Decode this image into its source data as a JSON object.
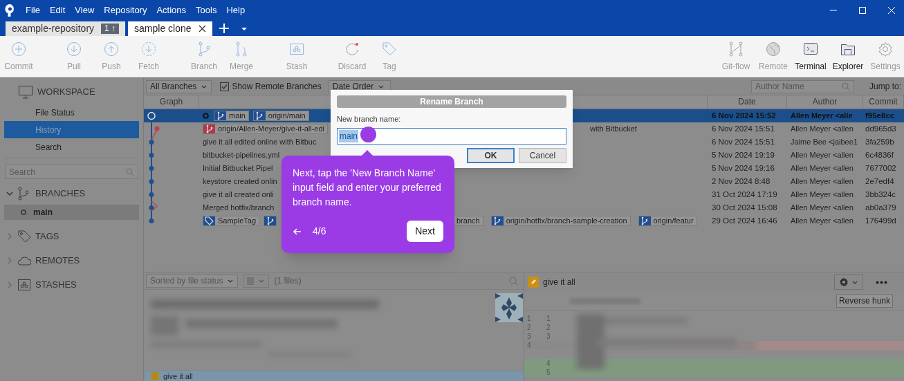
{
  "menu": [
    "File",
    "Edit",
    "View",
    "Repository",
    "Actions",
    "Tools",
    "Help"
  ],
  "tabs": [
    {
      "label": "example-repository",
      "badge": "1 ↑",
      "selected": false
    },
    {
      "label": "sample clone",
      "selected": true
    }
  ],
  "toolbar": {
    "groups": [
      [
        {
          "kind": "commit",
          "label": "Commit",
          "disabled": true
        }
      ],
      [
        {
          "kind": "pull",
          "label": "Pull",
          "disabled": true
        },
        {
          "kind": "push",
          "label": "Push",
          "disabled": true
        },
        {
          "kind": "fetch",
          "label": "Fetch",
          "disabled": true
        }
      ],
      [
        {
          "kind": "branch",
          "label": "Branch",
          "disabled": true
        },
        {
          "kind": "merge",
          "label": "Merge",
          "disabled": true
        }
      ],
      [
        {
          "kind": "stash",
          "label": "Stash",
          "disabled": true
        }
      ],
      [
        {
          "kind": "discard",
          "label": "Discard",
          "disabled": true
        },
        {
          "kind": "tag",
          "label": "Tag",
          "disabled": true
        }
      ]
    ],
    "right": [
      {
        "kind": "gitflow",
        "label": "Git-flow",
        "disabled": true
      },
      {
        "kind": "remote",
        "label": "Remote",
        "disabled": true
      },
      {
        "kind": "terminal",
        "label": "Terminal",
        "disabled": false
      },
      {
        "kind": "explorer",
        "label": "Explorer",
        "disabled": false
      },
      {
        "kind": "settings",
        "label": "Settings",
        "disabled": true
      }
    ]
  },
  "sidebar": {
    "workspace": {
      "label": "WORKSPACE",
      "items": [
        {
          "label": "File Status",
          "selected": false
        },
        {
          "label": "History",
          "selected": true
        },
        {
          "label": "Search",
          "selected": false
        }
      ]
    },
    "search": {
      "placeholder": "Search"
    },
    "sections": [
      {
        "kind": "branches",
        "label": "BRANCHES",
        "expanded": true,
        "children": [
          {
            "label": "main",
            "selected": true
          }
        ]
      },
      {
        "kind": "tags",
        "label": "TAGS",
        "expanded": false
      },
      {
        "kind": "remotes",
        "label": "REMOTES",
        "expanded": false
      },
      {
        "kind": "stashes",
        "label": "STASHES",
        "expanded": false
      }
    ]
  },
  "filters": {
    "branches": "All Branches",
    "show_remote": {
      "label": "Show Remote Branches",
      "checked": true
    },
    "order": "Date Order",
    "author": {
      "placeholder": "Author Name"
    },
    "jump": "Jump to:"
  },
  "columns": [
    "Graph",
    "Date",
    "Author",
    "Commit"
  ],
  "rows": [
    {
      "selected": true,
      "head": true,
      "refs": [
        {
          "kind": "branch",
          "label": "main",
          "color": "#1f4f8e"
        },
        {
          "kind": "branch",
          "label": "origin/main",
          "color": "#1f4f8e"
        }
      ],
      "date": "6 Nov 2024 15:52",
      "author": "Allen Meyer <alle",
      "commit": "f95e8cc"
    },
    {
      "selected": false,
      "refs": [
        {
          "kind": "branch",
          "label": "origin/Allen-Meyer/give-it-all-edi",
          "color": "#b03a48"
        }
      ],
      "text_right": "with Bitbucket",
      "date": "6 Nov 2024 15:51",
      "author": "Allen Meyer <allen",
      "commit": "dd965d3"
    },
    {
      "selected": false,
      "text": "give it all edited online with Bitbuc",
      "date": "6 Nov 2024 15:51",
      "author": "Jaime Bee <jaibee1",
      "commit": "3fa259b"
    },
    {
      "selected": false,
      "text": "bitbucket-pipelines.yml",
      "date": "5 Nov 2024 19:19",
      "author": "Allen Meyer <allen",
      "commit": "6c4836f"
    },
    {
      "selected": false,
      "text": "Initial Bitbucket Pipel",
      "date": "5 Nov 2024 19:16",
      "author": "Allen Meyer <allen",
      "commit": "7677002"
    },
    {
      "selected": false,
      "text": "keystore created onlin",
      "date": "2 Nov 2024 8:48",
      "author": "Allen Meyer <allen",
      "commit": "2e7edf4"
    },
    {
      "selected": false,
      "text": "give it all created onli",
      "date": "31 Oct 2024 17:19",
      "author": "Allen Meyer <allen",
      "commit": "3bb324c"
    },
    {
      "selected": false,
      "text": "Merged hotfix/branch",
      "date": "30 Oct 2024 15:08",
      "author": "Allen Meyer <allen",
      "commit": "ab0a379"
    },
    {
      "selected": false,
      "refs": [
        {
          "kind": "tag",
          "label": "SampleTag",
          "color": "#1f4f8e"
        },
        {
          "kind": "branch",
          "color": "#1f4f8e"
        }
      ],
      "refs_right": [
        {
          "kind": "fragment",
          "label": "branch"
        },
        {
          "kind": "branch",
          "label": "origin/hotfix/branch-sample-creation",
          "color": "#1f4f8e"
        },
        {
          "kind": "branch",
          "label": "origin/featur",
          "color": "#1f4f8e"
        }
      ],
      "date": "29 Oct 2024 16:46",
      "author": "Allen Meyer <allen",
      "commit": "176499d"
    }
  ],
  "file_list": {
    "sort": "Sorted by file status",
    "count": "(1 files)",
    "selected_file": "give it all"
  },
  "diff": {
    "file": "give it all",
    "reverse": "Reverse hunk",
    "lines": [
      {
        "old": "1",
        "new": "1",
        "kind": "context"
      },
      {
        "old": "2",
        "new": "2",
        "kind": "context"
      },
      {
        "old": "3",
        "new": "3",
        "kind": "context"
      },
      {
        "old": "4",
        "kind": "removed"
      },
      {
        "kind": "gap"
      },
      {
        "new": "4",
        "kind": "added"
      },
      {
        "new": "5",
        "kind": "added"
      }
    ]
  },
  "dialog": {
    "title": "Rename Branch",
    "label": "New branch name:",
    "value": "main",
    "buttons": [
      {
        "label": "OK",
        "default": true
      },
      {
        "label": "Cancel",
        "default": false
      }
    ]
  },
  "tour": {
    "text": "Next, tap the 'New Branch Name' input field and enter your preferred branch name.",
    "counter": "4/6",
    "next": "Next"
  }
}
